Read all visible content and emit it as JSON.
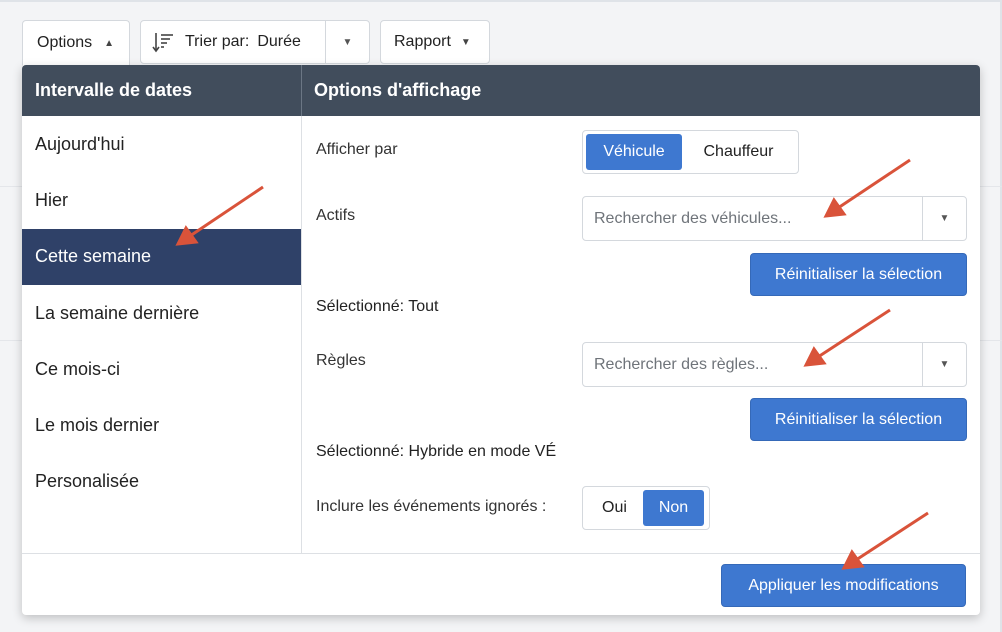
{
  "toolbar": {
    "options_label": "Options",
    "sort_label": "Trier par:",
    "sort_value": "Durée",
    "report_label": "Rapport"
  },
  "panel": {
    "left_header": "Intervalle de dates",
    "right_header": "Options d'affichage",
    "date_ranges": [
      {
        "label": "Aujourd'hui",
        "selected": false
      },
      {
        "label": "Hier",
        "selected": false
      },
      {
        "label": "Cette semaine",
        "selected": true
      },
      {
        "label": "La semaine dernière",
        "selected": false
      },
      {
        "label": "Ce mois-ci",
        "selected": false
      },
      {
        "label": "Le mois dernier",
        "selected": false
      },
      {
        "label": "Personalisée",
        "selected": false
      }
    ],
    "display_by": {
      "label": "Afficher par",
      "options": [
        "Véhicule",
        "Chauffeur"
      ],
      "selected": "Véhicule"
    },
    "assets": {
      "label": "Actifs",
      "placeholder": "Rechercher des véhicules...",
      "reset_label": "Réinitialiser la sélection",
      "selected_text": "Sélectionné: Tout"
    },
    "rules": {
      "label": "Règles",
      "placeholder": "Rechercher des règles...",
      "reset_label": "Réinitialiser la sélection",
      "selected_text": "Sélectionné: Hybride en mode VÉ"
    },
    "ignored_events": {
      "label": "Inclure les événements ignorés :",
      "options": [
        "Oui",
        "Non"
      ],
      "selected": "Non"
    },
    "apply_label": "Appliquer les modifications"
  },
  "colors": {
    "header_bg": "#414d5c",
    "active_item_bg": "#2f4168",
    "accent_blue": "#3e78d0",
    "annotation_arrow": "#d9533a"
  }
}
